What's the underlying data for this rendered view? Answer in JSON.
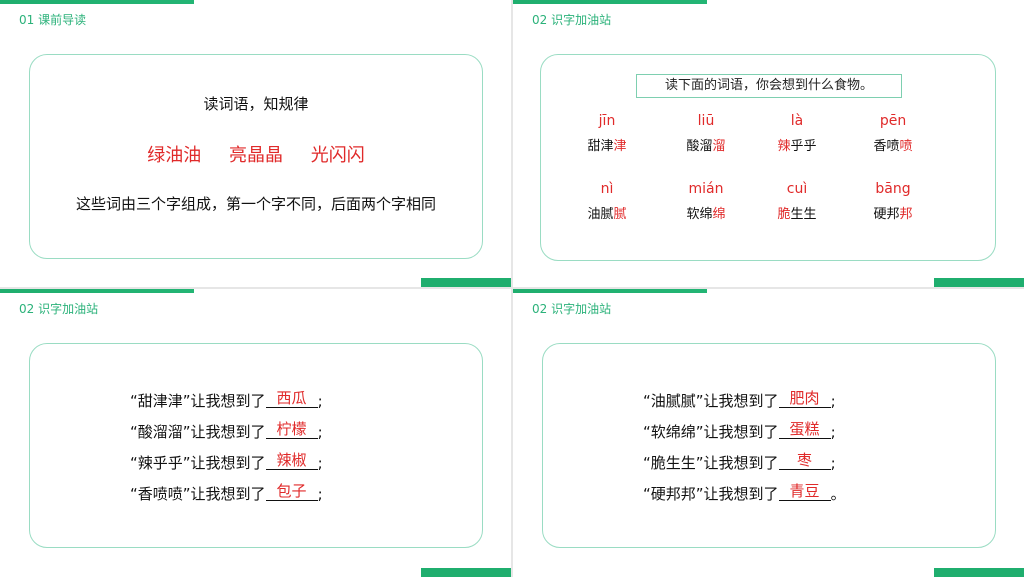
{
  "slides": [
    {
      "section": "01  课前导读",
      "subtitle": "读词语，知规律",
      "words": [
        "绿油油",
        "亮晶晶",
        "光闪闪"
      ],
      "rule": "这些词由三个字组成，第一个字不同，后面两个字相同"
    },
    {
      "section": "02  识字加油站",
      "prompt": "读下面的词语，你会想到什么食物。",
      "items": [
        {
          "pinyin": "jīn",
          "pre": "甜",
          "mid": "津",
          "post": "津",
          "hl": "post"
        },
        {
          "pinyin": "liū",
          "pre": "酸溜",
          "mid": "",
          "post": "溜",
          "hl": "post"
        },
        {
          "pinyin": "là",
          "pre": "",
          "mid": "辣",
          "post": "乎乎",
          "hl": "mid"
        },
        {
          "pinyin": "pēn",
          "pre": "香喷",
          "mid": "",
          "post": "喷",
          "hl": "post"
        },
        {
          "pinyin": "nì",
          "pre": "油腻",
          "mid": "",
          "post": "腻",
          "hl": "post"
        },
        {
          "pinyin": "mián",
          "pre": "软绵",
          "mid": "",
          "post": "绵",
          "hl": "post"
        },
        {
          "pinyin": "cuì",
          "pre": "",
          "mid": "脆",
          "post": "生生",
          "hl": "mid"
        },
        {
          "pinyin": "bāng",
          "pre": "硬邦",
          "mid": "",
          "post": "邦",
          "hl": "post"
        }
      ]
    },
    {
      "section": "02  识字加油站",
      "lines": [
        {
          "word": "“甜津津”",
          "text": "让我想到了",
          "answer": "西瓜",
          "end": ";"
        },
        {
          "word": "“酸溜溜”",
          "text": "让我想到了",
          "answer": "柠檬",
          "end": ";"
        },
        {
          "word": "“辣乎乎”",
          "text": "让我想到了",
          "answer": "辣椒",
          "end": ";"
        },
        {
          "word": "“香喷喷”",
          "text": "让我想到了",
          "answer": "包子",
          "end": ";"
        }
      ]
    },
    {
      "section": "02  识字加油站",
      "lines": [
        {
          "word": "“油腻腻”",
          "text": "让我想到了",
          "answer": "肥肉",
          "end": ";"
        },
        {
          "word": "“软绵绵”",
          "text": "让我想到了",
          "answer": "蛋糕",
          "end": ";"
        },
        {
          "word": "“脆生生”",
          "text": "让我想到了",
          "answer": "枣",
          "end": ";"
        },
        {
          "word": "“硬邦邦”",
          "text": "让我想到了",
          "answer": "青豆",
          "end": "。"
        }
      ]
    }
  ],
  "colors": {
    "accent": "#1fae6e",
    "highlight": "#e02a2a",
    "border": "#9adcc3"
  }
}
